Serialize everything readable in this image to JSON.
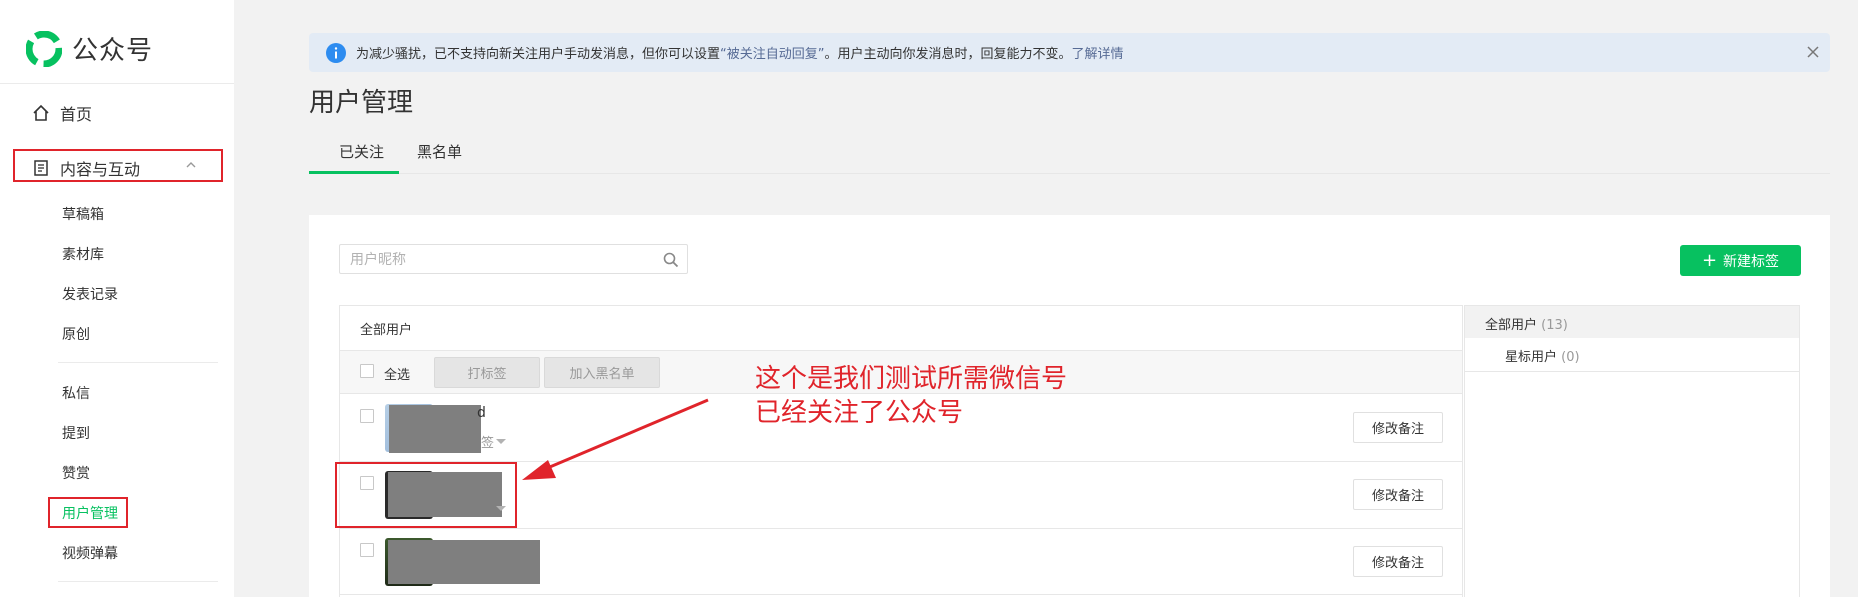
{
  "sidebar": {
    "logo_text": "公众号",
    "home_label": "首页",
    "content_label": "内容与互动",
    "content_sub": [
      "草稿箱",
      "素材库",
      "发表记录",
      "原创"
    ],
    "interact_sub": [
      "私信",
      "提到",
      "赞赏",
      "用户管理",
      "视频弹幕"
    ],
    "active_item": "用户管理",
    "icons": [
      "home-icon",
      "document-icon",
      "chevron-up-icon"
    ]
  },
  "notice": {
    "text_before": "为减少骚扰，已不支持向新关注用户手动发消息，但你可以设置",
    "link_auto_reply": "“被关注自动回复”",
    "text_after": "。用户主动向你发消息时，回复能力不变。",
    "link_more": "了解详情",
    "icons": [
      "info-icon",
      "close-icon"
    ]
  },
  "page": {
    "title": "用户管理",
    "tabs": [
      "已关注",
      "黑名单"
    ],
    "active_tab": "已关注"
  },
  "search": {
    "placeholder": "用户昵称",
    "value": ""
  },
  "toolbar": {
    "new_tag_label": "新建标签",
    "list_header": "全部用户",
    "select_all_label": "全选",
    "tag_button": "打标签",
    "blacklist_button": "加入黑名单"
  },
  "users": [
    {
      "name_partial": "d",
      "tag_partial": "签",
      "remark_button": "修改备注"
    },
    {
      "name_partial": "",
      "tag_partial": "",
      "remark_button": "修改备注"
    },
    {
      "name_partial": "",
      "tag_partial": "",
      "remark_button": "修改备注"
    }
  ],
  "tag_panel": {
    "all_users_label": "全部用户",
    "all_users_count": "(13)",
    "star_users_label": "星标用户",
    "star_users_count": "(0)"
  },
  "annotation": {
    "text": "这个是我们测试所需微信号\n已经关注了公众号"
  },
  "colors": {
    "accent": "#07c160",
    "annotation_red": "#e0242b",
    "link": "#576b95",
    "notice_bg": "#e3ebf5"
  }
}
